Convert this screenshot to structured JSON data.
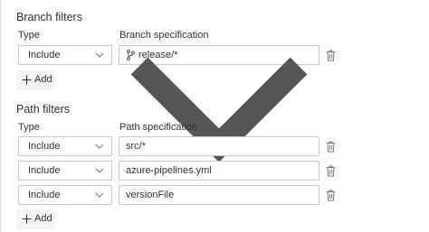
{
  "branch_filters": {
    "title": "Branch filters",
    "type_header": "Type",
    "spec_header": "Branch specification",
    "rows": [
      {
        "type": "Include",
        "spec": "release/*"
      }
    ],
    "add_label": "Add"
  },
  "path_filters": {
    "title": "Path filters",
    "type_header": "Type",
    "spec_header": "Path specification",
    "rows": [
      {
        "type": "Include",
        "spec": "src/*"
      },
      {
        "type": "Include",
        "spec": "azure-pipelines.yml"
      },
      {
        "type": "Include",
        "spec": "versionFile"
      }
    ],
    "add_label": "Add"
  },
  "icons": {
    "dropdown": "chevron-down-icon",
    "delete": "trash-icon",
    "add": "plus-icon",
    "branch": "branch-icon"
  },
  "colors": {
    "border": "#c8c8c8",
    "icon": "#777777",
    "button_bg": "#f4f4f4",
    "accent": "#0078d4"
  }
}
